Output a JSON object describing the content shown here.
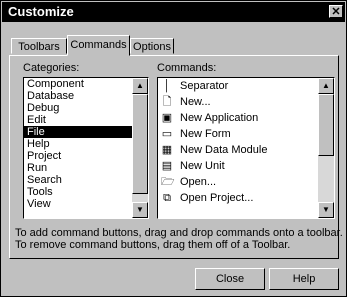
{
  "window": {
    "title": "Customize",
    "close_glyph": "✕"
  },
  "tabs": [
    {
      "label": "Toolbars"
    },
    {
      "label": "Commands"
    },
    {
      "label": "Options"
    }
  ],
  "categories": {
    "label": "Categories:",
    "items": [
      "Component",
      "Database",
      "Debug",
      "Edit",
      "File",
      "Help",
      "Project",
      "Run",
      "Search",
      "Tools",
      "View"
    ],
    "selected": "File"
  },
  "commands": {
    "label": "Commands:",
    "items": [
      {
        "label": "Separator",
        "icon": "separator-icon"
      },
      {
        "label": "New...",
        "icon": "new-document-icon"
      },
      {
        "label": "New Application",
        "icon": "new-application-icon"
      },
      {
        "label": "New Form",
        "icon": "new-form-icon"
      },
      {
        "label": "New Data Module",
        "icon": "new-data-module-icon"
      },
      {
        "label": "New Unit",
        "icon": "new-unit-icon"
      },
      {
        "label": "Open...",
        "icon": "open-folder-icon"
      },
      {
        "label": "Open Project...",
        "icon": "open-project-icon"
      }
    ]
  },
  "hint": {
    "line1": "To add command buttons, drag and drop commands onto a toolbar.",
    "line2": "To remove command buttons, drag them off of a Toolbar."
  },
  "buttons": {
    "close": "Close",
    "help": "Help"
  }
}
